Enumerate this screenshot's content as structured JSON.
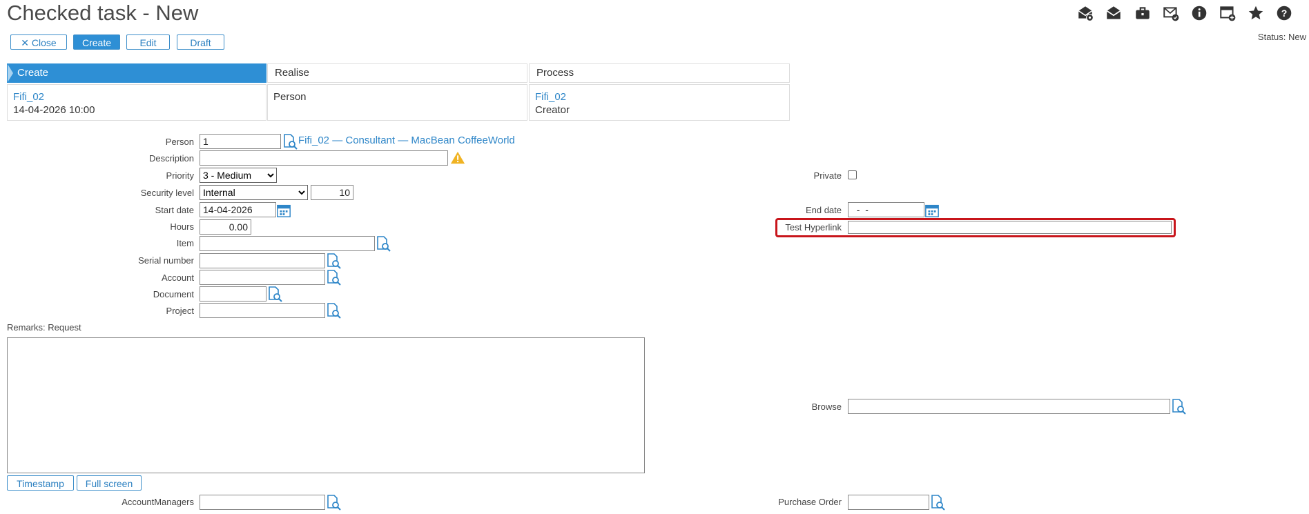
{
  "page": {
    "title": "Checked task - New",
    "status": "Status: New"
  },
  "toolbar": {
    "close_label": "Close",
    "create_label": "Create",
    "edit_label": "Edit",
    "draft_label": "Draft",
    "icons": [
      "envelope-settings-icon",
      "open-envelope-icon",
      "briefcase-icon",
      "envelope-check-icon",
      "info-icon",
      "calendar-add-icon",
      "star-icon",
      "help-icon"
    ]
  },
  "workflow": {
    "create": {
      "header": "Create",
      "link": "Fifi_02",
      "datetime": "14-04-2026 10:00"
    },
    "realise": {
      "header": "Realise",
      "value": "Person"
    },
    "process": {
      "header": "Process",
      "link": "Fifi_02",
      "role": "Creator"
    }
  },
  "form": {
    "person": {
      "label": "Person",
      "value": "1",
      "link": "Fifi_02 — Consultant — MacBean CoffeeWorld"
    },
    "description": {
      "label": "Description",
      "value": ""
    },
    "priority": {
      "label": "Priority",
      "selected": "3 - Medium"
    },
    "security_level": {
      "label": "Security level",
      "selected": "Internal",
      "value": "10"
    },
    "start_date": {
      "label": "Start date",
      "value": "14-04-2026"
    },
    "hours": {
      "label": "Hours",
      "value": "0.00"
    },
    "item": {
      "label": "Item",
      "value": ""
    },
    "serial_number": {
      "label": "Serial number",
      "value": ""
    },
    "account": {
      "label": "Account",
      "value": ""
    },
    "document": {
      "label": "Document",
      "value": ""
    },
    "project": {
      "label": "Project",
      "value": ""
    },
    "private": {
      "label": "Private",
      "checked": false
    },
    "end_date": {
      "label": "End date",
      "value": "  -  -"
    },
    "test_hyperlink": {
      "label": "Test Hyperlink",
      "value": ""
    },
    "browse": {
      "label": "Browse",
      "value": ""
    },
    "remarks": {
      "label": "Remarks: Request",
      "value": ""
    },
    "timestamp_label": "Timestamp",
    "fullscreen_label": "Full screen",
    "account_managers": {
      "label": "AccountManagers",
      "value": ""
    },
    "purchase_order": {
      "label": "Purchase Order",
      "value": ""
    }
  },
  "colors": {
    "accent": "#2e8fd5",
    "link": "#2e86c8",
    "highlight": "#c8151b",
    "warning": "#f0b323"
  }
}
